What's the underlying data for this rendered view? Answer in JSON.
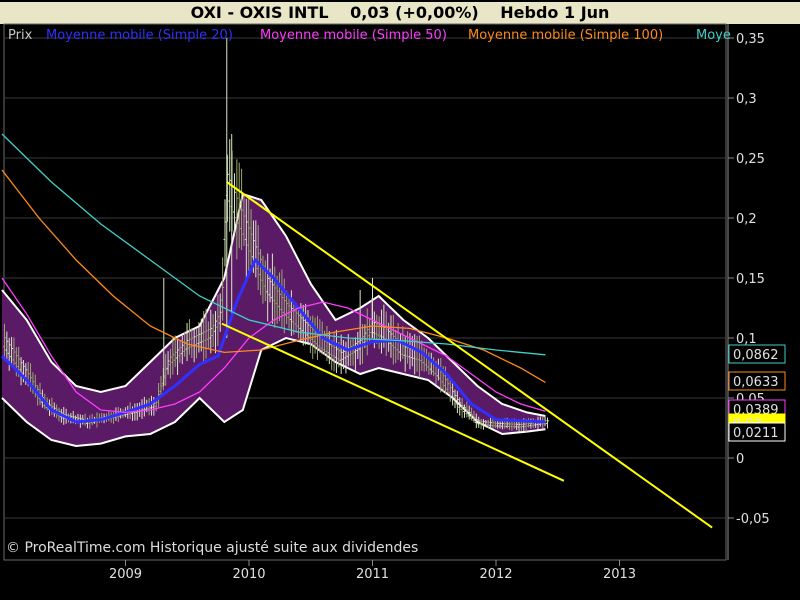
{
  "header": {
    "ticker": "OXI - OXIS INTL",
    "quote": "0,03 (+0,00%)",
    "period": "Hebdo  1 Jun"
  },
  "legend": [
    {
      "label": "Prix",
      "color": "#c8c8c8"
    },
    {
      "label": "Moyenne mobile (Simple 20)",
      "color": "#2f2fff"
    },
    {
      "label": "Moyenne mobile (Simple 50)",
      "color": "#ff3cff"
    },
    {
      "label": "Moyenne mobile (Simple 100)",
      "color": "#ff8a1a"
    },
    {
      "label": "Moye",
      "color": "#40d0c8"
    }
  ],
  "credit": "© ProRealTime.com Historique ajusté suite aux dividendes",
  "chart_data": {
    "type": "line",
    "x_ticks": [
      "2009",
      "2010",
      "2011",
      "2012",
      "2013"
    ],
    "y_ticks": [
      "0,35",
      "0,3",
      "0,25",
      "0,2",
      "0,15",
      "0,1",
      "0,05",
      "0",
      "-0,05"
    ],
    "ylim": [
      -0.07,
      0.36
    ],
    "price_labels": [
      {
        "text": "0,0862",
        "value": 0.0862,
        "color": "#40d0c8"
      },
      {
        "text": "0,0633",
        "value": 0.0633,
        "color": "#ff8a1a"
      },
      {
        "text": "0,0389",
        "value": 0.0389,
        "color": "#ff3cff"
      },
      {
        "text": "0,03",
        "value": 0.03,
        "color": "#ffff00"
      },
      {
        "text": "0,0211",
        "value": 0.0211,
        "color": "#ffffff"
      }
    ],
    "price": [
      {
        "t": 2008.0,
        "v": 0.1
      },
      {
        "t": 2008.1,
        "v": 0.085
      },
      {
        "t": 2008.2,
        "v": 0.07
      },
      {
        "t": 2008.35,
        "v": 0.045
      },
      {
        "t": 2008.5,
        "v": 0.035
      },
      {
        "t": 2008.7,
        "v": 0.03
      },
      {
        "t": 2008.9,
        "v": 0.035
      },
      {
        "t": 2009.1,
        "v": 0.04
      },
      {
        "t": 2009.25,
        "v": 0.045
      },
      {
        "t": 2009.35,
        "v": 0.08
      },
      {
        "t": 2009.5,
        "v": 0.095
      },
      {
        "t": 2009.6,
        "v": 0.1
      },
      {
        "t": 2009.7,
        "v": 0.105
      },
      {
        "t": 2009.78,
        "v": 0.12
      },
      {
        "t": 2009.82,
        "v": 0.23
      },
      {
        "t": 2009.9,
        "v": 0.21
      },
      {
        "t": 2010.0,
        "v": 0.185
      },
      {
        "t": 2010.15,
        "v": 0.145
      },
      {
        "t": 2010.3,
        "v": 0.125
      },
      {
        "t": 2010.45,
        "v": 0.11
      },
      {
        "t": 2010.6,
        "v": 0.095
      },
      {
        "t": 2010.75,
        "v": 0.085
      },
      {
        "t": 2010.9,
        "v": 0.095
      },
      {
        "t": 2011.0,
        "v": 0.11
      },
      {
        "t": 2011.1,
        "v": 0.105
      },
      {
        "t": 2011.25,
        "v": 0.09
      },
      {
        "t": 2011.4,
        "v": 0.085
      },
      {
        "t": 2011.55,
        "v": 0.07
      },
      {
        "t": 2011.7,
        "v": 0.045
      },
      {
        "t": 2011.85,
        "v": 0.03
      },
      {
        "t": 2012.0,
        "v": 0.028
      },
      {
        "t": 2012.2,
        "v": 0.027
      },
      {
        "t": 2012.4,
        "v": 0.03
      }
    ],
    "series": [
      {
        "key": "sma20",
        "color": "#3030ff",
        "points": [
          {
            "t": 2008.0,
            "v": 0.085
          },
          {
            "t": 2008.2,
            "v": 0.065
          },
          {
            "t": 2008.4,
            "v": 0.04
          },
          {
            "t": 2008.6,
            "v": 0.03
          },
          {
            "t": 2008.8,
            "v": 0.032
          },
          {
            "t": 2009.0,
            "v": 0.038
          },
          {
            "t": 2009.2,
            "v": 0.045
          },
          {
            "t": 2009.4,
            "v": 0.06
          },
          {
            "t": 2009.6,
            "v": 0.078
          },
          {
            "t": 2009.75,
            "v": 0.085
          },
          {
            "t": 2009.9,
            "v": 0.13
          },
          {
            "t": 2010.05,
            "v": 0.165
          },
          {
            "t": 2010.2,
            "v": 0.15
          },
          {
            "t": 2010.4,
            "v": 0.125
          },
          {
            "t": 2010.6,
            "v": 0.1
          },
          {
            "t": 2010.8,
            "v": 0.09
          },
          {
            "t": 2011.0,
            "v": 0.097
          },
          {
            "t": 2011.2,
            "v": 0.098
          },
          {
            "t": 2011.4,
            "v": 0.088
          },
          {
            "t": 2011.6,
            "v": 0.07
          },
          {
            "t": 2011.8,
            "v": 0.045
          },
          {
            "t": 2012.0,
            "v": 0.032
          },
          {
            "t": 2012.2,
            "v": 0.031
          },
          {
            "t": 2012.4,
            "v": 0.03
          }
        ]
      },
      {
        "key": "sma50",
        "color": "#ff3cff",
        "points": [
          {
            "t": 2008.0,
            "v": 0.15
          },
          {
            "t": 2008.2,
            "v": 0.12
          },
          {
            "t": 2008.4,
            "v": 0.085
          },
          {
            "t": 2008.6,
            "v": 0.055
          },
          {
            "t": 2008.8,
            "v": 0.04
          },
          {
            "t": 2009.0,
            "v": 0.038
          },
          {
            "t": 2009.2,
            "v": 0.04
          },
          {
            "t": 2009.4,
            "v": 0.045
          },
          {
            "t": 2009.6,
            "v": 0.055
          },
          {
            "t": 2009.8,
            "v": 0.075
          },
          {
            "t": 2010.0,
            "v": 0.1
          },
          {
            "t": 2010.2,
            "v": 0.115
          },
          {
            "t": 2010.4,
            "v": 0.125
          },
          {
            "t": 2010.6,
            "v": 0.13
          },
          {
            "t": 2010.8,
            "v": 0.125
          },
          {
            "t": 2011.0,
            "v": 0.115
          },
          {
            "t": 2011.2,
            "v": 0.105
          },
          {
            "t": 2011.4,
            "v": 0.095
          },
          {
            "t": 2011.6,
            "v": 0.085
          },
          {
            "t": 2011.8,
            "v": 0.07
          },
          {
            "t": 2012.0,
            "v": 0.055
          },
          {
            "t": 2012.2,
            "v": 0.045
          },
          {
            "t": 2012.4,
            "v": 0.039
          }
        ]
      },
      {
        "key": "sma100",
        "color": "#ff8a1a",
        "points": [
          {
            "t": 2008.0,
            "v": 0.24
          },
          {
            "t": 2008.3,
            "v": 0.2
          },
          {
            "t": 2008.6,
            "v": 0.165
          },
          {
            "t": 2008.9,
            "v": 0.135
          },
          {
            "t": 2009.2,
            "v": 0.11
          },
          {
            "t": 2009.5,
            "v": 0.095
          },
          {
            "t": 2009.8,
            "v": 0.088
          },
          {
            "t": 2010.1,
            "v": 0.09
          },
          {
            "t": 2010.4,
            "v": 0.098
          },
          {
            "t": 2010.7,
            "v": 0.105
          },
          {
            "t": 2011.0,
            "v": 0.11
          },
          {
            "t": 2011.3,
            "v": 0.108
          },
          {
            "t": 2011.6,
            "v": 0.1
          },
          {
            "t": 2011.9,
            "v": 0.09
          },
          {
            "t": 2012.2,
            "v": 0.075
          },
          {
            "t": 2012.4,
            "v": 0.063
          }
        ]
      },
      {
        "key": "sma200",
        "color": "#40d0c8",
        "points": [
          {
            "t": 2008.0,
            "v": 0.27
          },
          {
            "t": 2008.4,
            "v": 0.23
          },
          {
            "t": 2008.8,
            "v": 0.195
          },
          {
            "t": 2009.2,
            "v": 0.165
          },
          {
            "t": 2009.6,
            "v": 0.135
          },
          {
            "t": 2010.0,
            "v": 0.115
          },
          {
            "t": 2010.4,
            "v": 0.105
          },
          {
            "t": 2010.8,
            "v": 0.1
          },
          {
            "t": 2011.2,
            "v": 0.098
          },
          {
            "t": 2011.6,
            "v": 0.095
          },
          {
            "t": 2012.0,
            "v": 0.09
          },
          {
            "t": 2012.4,
            "v": 0.086
          }
        ]
      }
    ],
    "bollinger_upper": [
      {
        "t": 2008.0,
        "v": 0.14
      },
      {
        "t": 2008.2,
        "v": 0.115
      },
      {
        "t": 2008.4,
        "v": 0.08
      },
      {
        "t": 2008.6,
        "v": 0.06
      },
      {
        "t": 2008.8,
        "v": 0.055
      },
      {
        "t": 2009.0,
        "v": 0.06
      },
      {
        "t": 2009.2,
        "v": 0.08
      },
      {
        "t": 2009.4,
        "v": 0.1
      },
      {
        "t": 2009.6,
        "v": 0.11
      },
      {
        "t": 2009.8,
        "v": 0.15
      },
      {
        "t": 2009.95,
        "v": 0.22
      },
      {
        "t": 2010.1,
        "v": 0.215
      },
      {
        "t": 2010.3,
        "v": 0.185
      },
      {
        "t": 2010.5,
        "v": 0.145
      },
      {
        "t": 2010.7,
        "v": 0.115
      },
      {
        "t": 2010.9,
        "v": 0.125
      },
      {
        "t": 2011.05,
        "v": 0.135
      },
      {
        "t": 2011.25,
        "v": 0.115
      },
      {
        "t": 2011.45,
        "v": 0.1
      },
      {
        "t": 2011.65,
        "v": 0.08
      },
      {
        "t": 2011.85,
        "v": 0.06
      },
      {
        "t": 2012.05,
        "v": 0.045
      },
      {
        "t": 2012.25,
        "v": 0.038
      },
      {
        "t": 2012.4,
        "v": 0.035
      }
    ],
    "bollinger_lower": [
      {
        "t": 2008.0,
        "v": 0.05
      },
      {
        "t": 2008.2,
        "v": 0.03
      },
      {
        "t": 2008.4,
        "v": 0.015
      },
      {
        "t": 2008.6,
        "v": 0.01
      },
      {
        "t": 2008.8,
        "v": 0.012
      },
      {
        "t": 2009.0,
        "v": 0.018
      },
      {
        "t": 2009.2,
        "v": 0.02
      },
      {
        "t": 2009.4,
        "v": 0.03
      },
      {
        "t": 2009.6,
        "v": 0.05
      },
      {
        "t": 2009.8,
        "v": 0.03
      },
      {
        "t": 2009.95,
        "v": 0.04
      },
      {
        "t": 2010.1,
        "v": 0.09
      },
      {
        "t": 2010.3,
        "v": 0.1
      },
      {
        "t": 2010.5,
        "v": 0.095
      },
      {
        "t": 2010.7,
        "v": 0.08
      },
      {
        "t": 2010.9,
        "v": 0.07
      },
      {
        "t": 2011.05,
        "v": 0.075
      },
      {
        "t": 2011.25,
        "v": 0.07
      },
      {
        "t": 2011.45,
        "v": 0.065
      },
      {
        "t": 2011.65,
        "v": 0.05
      },
      {
        "t": 2011.85,
        "v": 0.03
      },
      {
        "t": 2012.05,
        "v": 0.02
      },
      {
        "t": 2012.25,
        "v": 0.022
      },
      {
        "t": 2012.4,
        "v": 0.024
      }
    ],
    "trendlines": [
      {
        "from": {
          "t": 2009.82,
          "v": 0.23
        },
        "to": {
          "t": 2013.75,
          "v": -0.058
        }
      },
      {
        "from": {
          "t": 2009.78,
          "v": 0.112
        },
        "to": {
          "t": 2012.55,
          "v": -0.019
        }
      }
    ]
  }
}
